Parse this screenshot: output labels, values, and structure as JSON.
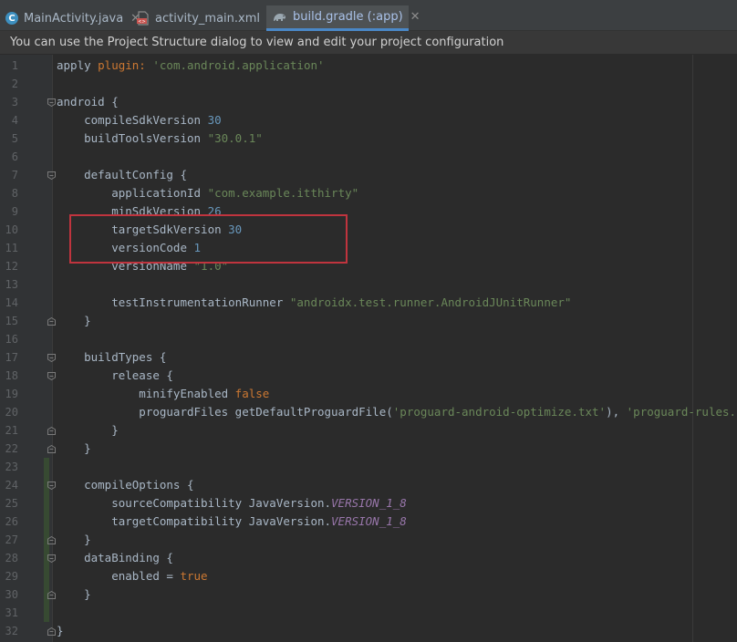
{
  "tabs": [
    {
      "label": "MainActivity.java",
      "icon": "java-class-icon",
      "active": false
    },
    {
      "label": "activity_main.xml",
      "icon": "xml-file-icon",
      "active": false
    },
    {
      "label": "build.gradle (:app)",
      "icon": "gradle-icon",
      "active": true
    }
  ],
  "banner": {
    "text": "You can use the Project Structure dialog to view and edit your project configuration"
  },
  "colors": {
    "keyword": "#cc7832",
    "string": "#6a8759",
    "number": "#6897bb",
    "constant": "#9876aa",
    "plain": "#a9b7c6",
    "highlight": "#c0343e"
  },
  "editor": {
    "lines": [
      {
        "num": "1",
        "tokens": [
          {
            "t": "plain",
            "v": "apply "
          },
          {
            "t": "kw",
            "v": "plugin: "
          },
          {
            "t": "str",
            "v": "'com.android.application'"
          }
        ]
      },
      {
        "num": "2",
        "tokens": []
      },
      {
        "num": "3",
        "tokens": [
          {
            "t": "plain",
            "v": "android {"
          }
        ]
      },
      {
        "num": "4",
        "tokens": [
          {
            "t": "plain",
            "v": "    compileSdkVersion "
          },
          {
            "t": "num",
            "v": "30"
          }
        ]
      },
      {
        "num": "5",
        "tokens": [
          {
            "t": "plain",
            "v": "    buildToolsVersion "
          },
          {
            "t": "str",
            "v": "\"30.0.1\""
          }
        ]
      },
      {
        "num": "6",
        "tokens": []
      },
      {
        "num": "7",
        "tokens": [
          {
            "t": "plain",
            "v": "    defaultConfig {"
          }
        ]
      },
      {
        "num": "8",
        "tokens": [
          {
            "t": "plain",
            "v": "        applicationId "
          },
          {
            "t": "str",
            "v": "\"com.example.itthirty\""
          }
        ]
      },
      {
        "num": "9",
        "tokens": [
          {
            "t": "plain",
            "v": "        minSdkVersion "
          },
          {
            "t": "num",
            "v": "26"
          }
        ]
      },
      {
        "num": "10",
        "tokens": [
          {
            "t": "plain",
            "v": "        targetSdkVersion "
          },
          {
            "t": "num",
            "v": "30"
          }
        ]
      },
      {
        "num": "11",
        "tokens": [
          {
            "t": "plain",
            "v": "        versionCode "
          },
          {
            "t": "num",
            "v": "1"
          }
        ]
      },
      {
        "num": "12",
        "tokens": [
          {
            "t": "plain",
            "v": "        versionName "
          },
          {
            "t": "str",
            "v": "\"1.0\""
          }
        ]
      },
      {
        "num": "13",
        "tokens": []
      },
      {
        "num": "14",
        "tokens": [
          {
            "t": "plain",
            "v": "        testInstrumentationRunner "
          },
          {
            "t": "str",
            "v": "\"androidx.test.runner.AndroidJUnitRunner\""
          }
        ]
      },
      {
        "num": "15",
        "tokens": [
          {
            "t": "plain",
            "v": "    }"
          }
        ]
      },
      {
        "num": "16",
        "tokens": []
      },
      {
        "num": "17",
        "tokens": [
          {
            "t": "plain",
            "v": "    buildTypes {"
          }
        ]
      },
      {
        "num": "18",
        "tokens": [
          {
            "t": "plain",
            "v": "        release {"
          }
        ]
      },
      {
        "num": "19",
        "tokens": [
          {
            "t": "plain",
            "v": "            minifyEnabled "
          },
          {
            "t": "kw",
            "v": "false"
          }
        ]
      },
      {
        "num": "20",
        "tokens": [
          {
            "t": "plain",
            "v": "            proguardFiles getDefaultProguardFile("
          },
          {
            "t": "str",
            "v": "'proguard-android-optimize.txt'"
          },
          {
            "t": "plain",
            "v": "), "
          },
          {
            "t": "str",
            "v": "'proguard-rules.pro'"
          }
        ]
      },
      {
        "num": "21",
        "tokens": [
          {
            "t": "plain",
            "v": "        }"
          }
        ]
      },
      {
        "num": "22",
        "tokens": [
          {
            "t": "plain",
            "v": "    }"
          }
        ]
      },
      {
        "num": "23",
        "tokens": []
      },
      {
        "num": "24",
        "tokens": [
          {
            "t": "plain",
            "v": "    compileOptions {"
          }
        ]
      },
      {
        "num": "25",
        "tokens": [
          {
            "t": "plain",
            "v": "        sourceCompatibility JavaVersion."
          },
          {
            "t": "const",
            "v": "VERSION_1_8"
          }
        ]
      },
      {
        "num": "26",
        "tokens": [
          {
            "t": "plain",
            "v": "        targetCompatibility JavaVersion."
          },
          {
            "t": "const",
            "v": "VERSION_1_8"
          }
        ]
      },
      {
        "num": "27",
        "tokens": [
          {
            "t": "plain",
            "v": "    }"
          }
        ]
      },
      {
        "num": "28",
        "tokens": [
          {
            "t": "plain",
            "v": "    dataBinding {"
          }
        ]
      },
      {
        "num": "29",
        "tokens": [
          {
            "t": "plain",
            "v": "        enabled = "
          },
          {
            "t": "kw",
            "v": "true"
          }
        ]
      },
      {
        "num": "30",
        "tokens": [
          {
            "t": "plain",
            "v": "    }"
          }
        ]
      },
      {
        "num": "31",
        "tokens": []
      },
      {
        "num": "32",
        "tokens": [
          {
            "t": "plain",
            "v": "}"
          }
        ]
      }
    ]
  }
}
